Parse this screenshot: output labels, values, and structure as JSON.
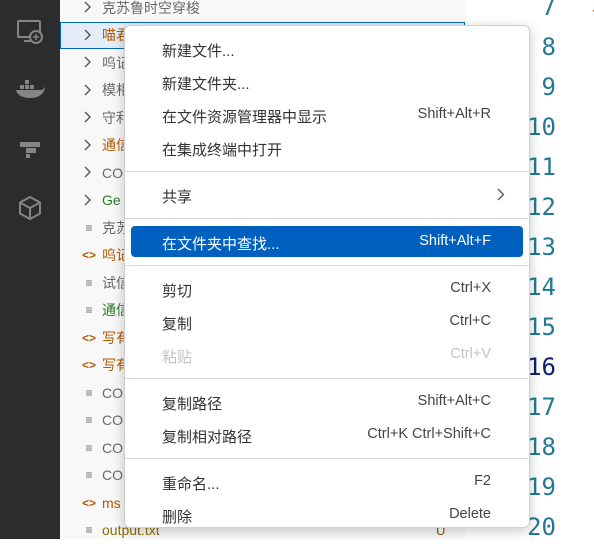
{
  "activity_bar": {
    "icons": [
      "remote-explorer-icon",
      "docker-icon",
      "azure-icon",
      "package-icon"
    ]
  },
  "explorer": {
    "rows": [
      {
        "kind": "folder",
        "name": "克苏鲁时空穿梭"
      },
      {
        "kind": "folder",
        "name": "喵君",
        "selected": true
      },
      {
        "kind": "folder",
        "name": "呜记"
      },
      {
        "kind": "folder",
        "name": "模相"
      },
      {
        "kind": "folder",
        "name": "守利"
      },
      {
        "kind": "folder",
        "name": "通信"
      },
      {
        "kind": "folder",
        "name": "CO"
      },
      {
        "kind": "folder",
        "name": "Ge"
      },
      {
        "kind": "file",
        "icon": "≡",
        "name": "克苏"
      },
      {
        "kind": "file",
        "icon": "<>",
        "name": "呜记"
      },
      {
        "kind": "file",
        "icon": "≡",
        "name": "试信"
      },
      {
        "kind": "file",
        "icon": "≡",
        "name": "通信"
      },
      {
        "kind": "file",
        "icon": "<>",
        "name": "写有"
      },
      {
        "kind": "file",
        "icon": "<>",
        "name": "写有"
      },
      {
        "kind": "file",
        "icon": "≡",
        "name": "CO"
      },
      {
        "kind": "file",
        "icon": "≡",
        "name": "CO"
      },
      {
        "kind": "file",
        "icon": "≡",
        "name": "CO"
      },
      {
        "kind": "file",
        "icon": "≡",
        "name": "CO"
      },
      {
        "kind": "file",
        "icon": "<>",
        "name": "ms"
      },
      {
        "kind": "file",
        "icon": "≡",
        "name": "output.txt",
        "badge": "U"
      }
    ]
  },
  "editor": {
    "line_numbers": [
      "7",
      "8",
      "9",
      "10",
      "11",
      "12",
      "13",
      "14",
      "15",
      "16",
      "17",
      "18",
      "19",
      "20"
    ],
    "active_line": "16"
  },
  "context_menu": {
    "groups": [
      [
        {
          "label": "新建文件...",
          "shortcut": ""
        },
        {
          "label": "新建文件夹...",
          "shortcut": ""
        },
        {
          "label": "在文件资源管理器中显示",
          "shortcut": "Shift+Alt+R"
        },
        {
          "label": "在集成终端中打开",
          "shortcut": ""
        }
      ],
      [
        {
          "label": "共享",
          "shortcut": "",
          "submenu": true
        }
      ],
      [
        {
          "label": "在文件夹中查找...",
          "shortcut": "Shift+Alt+F",
          "highlighted": true
        }
      ],
      [
        {
          "label": "剪切",
          "shortcut": "Ctrl+X"
        },
        {
          "label": "复制",
          "shortcut": "Ctrl+C"
        },
        {
          "label": "粘贴",
          "shortcut": "Ctrl+V",
          "disabled": true
        }
      ],
      [
        {
          "label": "复制路径",
          "shortcut": "Shift+Alt+C"
        },
        {
          "label": "复制相对路径",
          "shortcut": "Ctrl+K Ctrl+Shift+C"
        }
      ],
      [
        {
          "label": "重命名...",
          "shortcut": "F2"
        },
        {
          "label": "删除",
          "shortcut": "Delete"
        }
      ]
    ]
  },
  "colors": {
    "activity_bar_bg": "#2c2c2c",
    "menu_highlight": "#0060c0",
    "line_number": "#237893"
  }
}
